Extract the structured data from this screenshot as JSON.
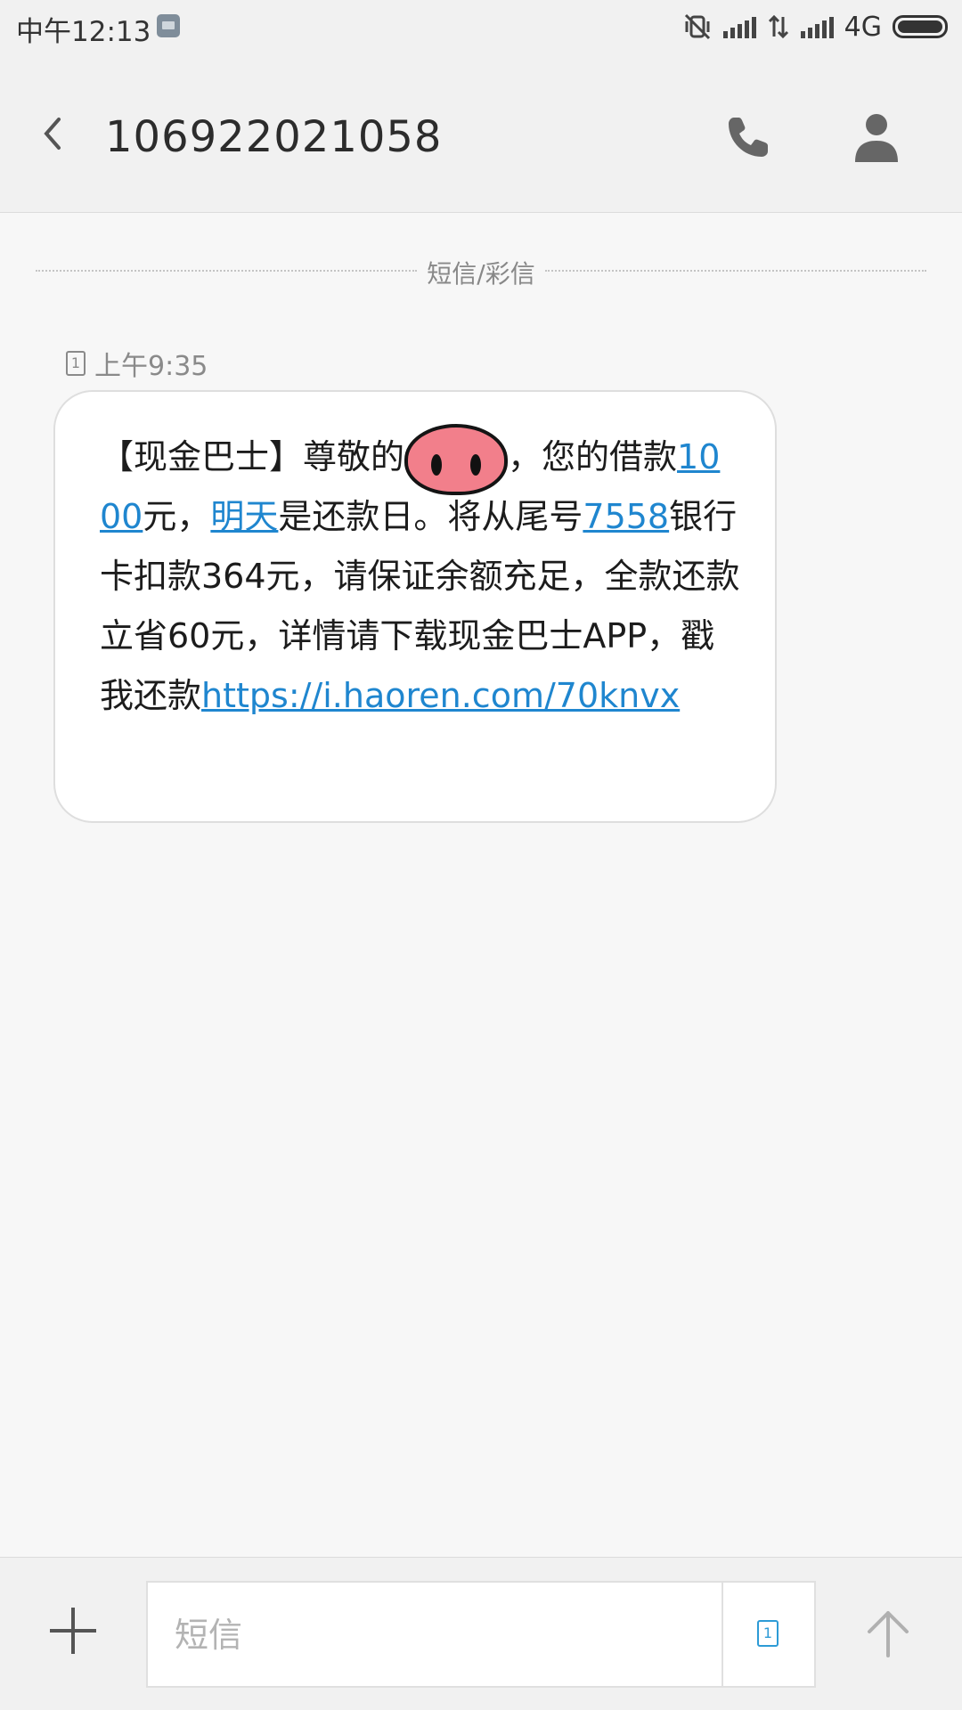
{
  "status_bar": {
    "time": "中午12:13",
    "network": "4G"
  },
  "header": {
    "title": "106922021058"
  },
  "thread": {
    "divider_label": "短信/彩信",
    "sim_slot": "1",
    "timestamp": "上午9:35",
    "message": {
      "part1": "【现金巴士】尊敬的",
      "part2": "，您的借款",
      "amount_link": "1000",
      "part3": "元，",
      "date_link": "明天",
      "part4": "是还款日。将从尾号",
      "card_link": "7558",
      "part5": "银行卡扣款364元，请保证余额充足，全款还款立省60元，详情请下载现金巴士APP，戳我还款",
      "url_link": "https://i.haoren.com/70knvx"
    }
  },
  "composer": {
    "placeholder": "短信",
    "sim_slot": "1"
  },
  "colors": {
    "link": "#1f86cf",
    "sim_accent": "#2d9bd6",
    "redaction": "#f27f8b"
  },
  "icons": {
    "back": "chevron-left-icon",
    "call": "phone-icon",
    "contact": "person-icon",
    "add": "plus-icon",
    "send": "arrow-up-icon"
  }
}
